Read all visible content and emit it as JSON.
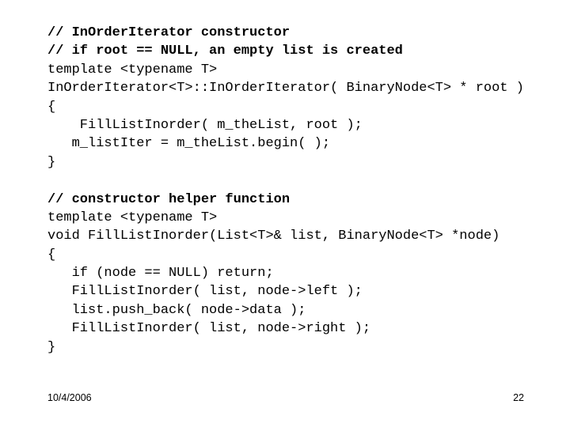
{
  "slide": {
    "background_color": "#ffffff",
    "text_color": "#000000",
    "code": {
      "lines": [
        {
          "text": "// InOrderIterator constructor",
          "style": "comment"
        },
        {
          "text": "// if root == NULL, an empty list is created",
          "style": "comment"
        },
        {
          "text": "template <typename T>",
          "style": "code"
        },
        {
          "text": "InOrderIterator<T>::InOrderIterator( BinaryNode<T> * root )",
          "style": "code"
        },
        {
          "text": "{",
          "style": "code"
        },
        {
          "text": "    FillListInorder( m_theList, root );",
          "style": "code"
        },
        {
          "text": "   m_listIter = m_theList.begin( );",
          "style": "code"
        },
        {
          "text": "}",
          "style": "code"
        },
        {
          "text": "",
          "style": "blank"
        },
        {
          "text": "// constructor helper function",
          "style": "comment"
        },
        {
          "text": "template <typename T>",
          "style": "code"
        },
        {
          "text": "void FillListInorder(List<T>& list, BinaryNode<T> *node)",
          "style": "code"
        },
        {
          "text": "{",
          "style": "code"
        },
        {
          "text": "   if (node == NULL) return;",
          "style": "code"
        },
        {
          "text": "   FillListInorder( list, node->left );",
          "style": "code"
        },
        {
          "text": "   list.push_back( node->data );",
          "style": "code"
        },
        {
          "text": "   FillListInorder( list, node->right );",
          "style": "code"
        },
        {
          "text": "}",
          "style": "code"
        }
      ]
    },
    "footer": {
      "date": "10/4/2006",
      "page_number": "22"
    }
  }
}
